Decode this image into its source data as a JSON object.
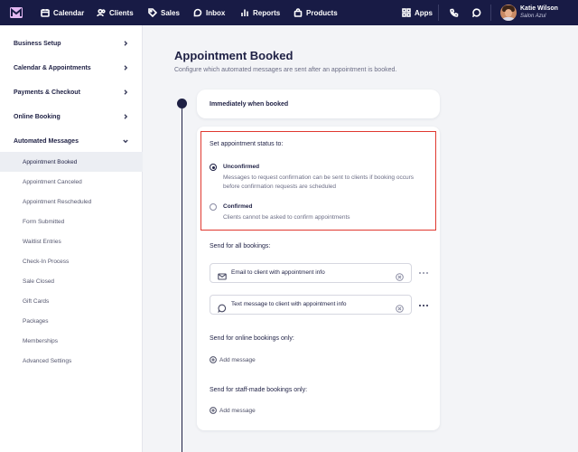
{
  "nav": {
    "items": [
      {
        "label": "Calendar",
        "icon": "calendar-icon"
      },
      {
        "label": "Clients",
        "icon": "clients-icon"
      },
      {
        "label": "Sales",
        "icon": "tag-icon"
      },
      {
        "label": "Inbox",
        "icon": "inbox-icon"
      },
      {
        "label": "Reports",
        "icon": "reports-icon"
      },
      {
        "label": "Products",
        "icon": "bag-icon"
      }
    ],
    "apps_label": "Apps",
    "user": {
      "name": "Katie Wilson",
      "business": "Salon Azul"
    }
  },
  "sidebar": {
    "sections": [
      {
        "label": "Business Setup",
        "expanded": false
      },
      {
        "label": "Calendar & Appointments",
        "expanded": false
      },
      {
        "label": "Payments & Checkout",
        "expanded": false
      },
      {
        "label": "Online Booking",
        "expanded": false
      },
      {
        "label": "Automated Messages",
        "expanded": true
      }
    ],
    "sub_items": [
      {
        "label": "Appointment Booked",
        "active": true
      },
      {
        "label": "Appointment Canceled",
        "active": false
      },
      {
        "label": "Appointment Rescheduled",
        "active": false
      },
      {
        "label": "Form Submitted",
        "active": false
      },
      {
        "label": "Waitlist Entries",
        "active": false
      },
      {
        "label": "Check-In Process",
        "active": false
      },
      {
        "label": "Sale Closed",
        "active": false
      },
      {
        "label": "Gift Cards",
        "active": false
      },
      {
        "label": "Packages",
        "active": false
      },
      {
        "label": "Memberships",
        "active": false
      },
      {
        "label": "Advanced Settings",
        "active": false
      }
    ]
  },
  "main": {
    "title": "Appointment Booked",
    "description": "Configure which automated messages are sent after an appointment is booked.",
    "trigger": "Immediately when booked",
    "status": {
      "title": "Set appointment status to:",
      "selected": "Unconfirmed",
      "options": [
        {
          "label": "Unconfirmed",
          "description": "Messages to request confirmation can be sent to clients if booking occurs before confirmation requests are scheduled"
        },
        {
          "label": "Confirmed",
          "description": "Clients cannot be asked to confirm appointments"
        }
      ]
    },
    "all_bookings": {
      "heading": "Send for all bookings:",
      "messages": [
        {
          "label": "Email to client with appointment info",
          "icon": "mail-icon"
        },
        {
          "label": "Text message to client with appointment info",
          "icon": "chat-icon"
        }
      ]
    },
    "online_bookings": {
      "heading": "Send for online bookings only:",
      "add_label": "Add message"
    },
    "staff_bookings": {
      "heading": "Send for staff-made bookings only:",
      "add_label": "Add message"
    }
  },
  "colors": {
    "nav_bg": "#181b45",
    "highlight_border": "#e0382f",
    "text_primary": "#1e2044",
    "logo_accent": "#e3b8f2"
  }
}
